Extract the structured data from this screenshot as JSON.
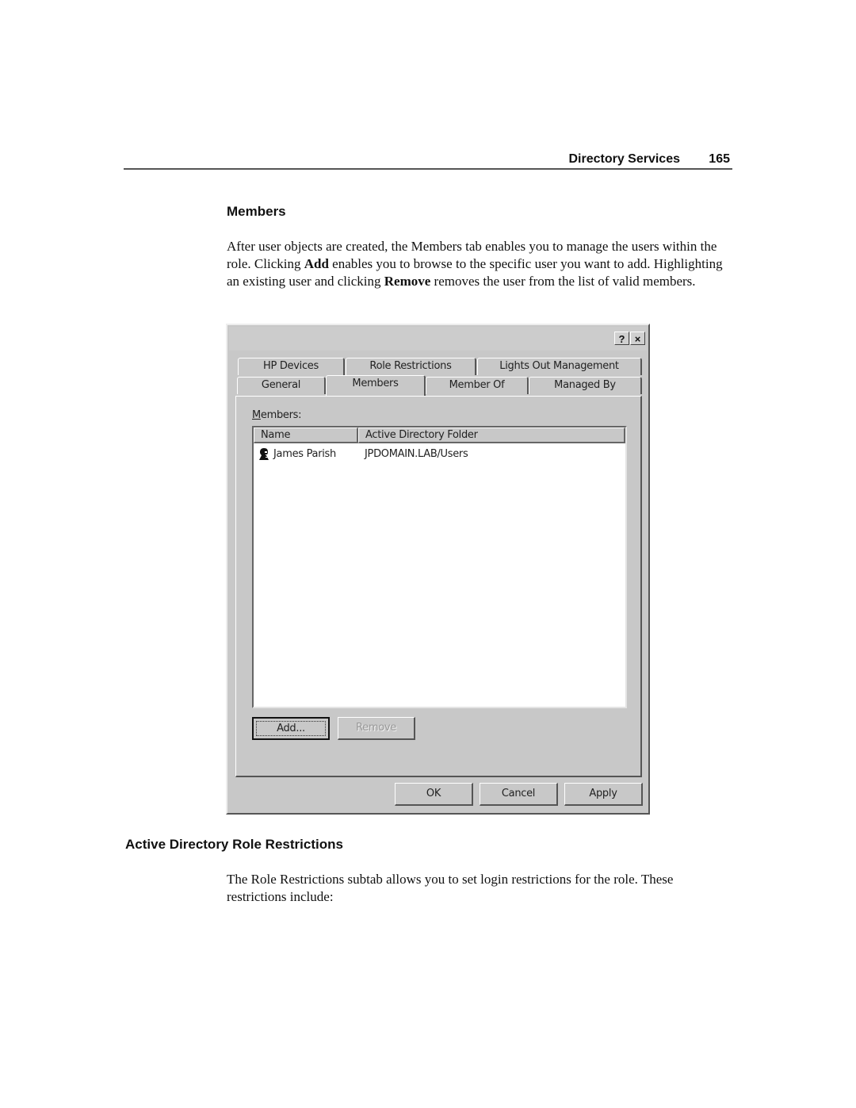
{
  "running_header": {
    "section": "Directory Services",
    "page_number": "165"
  },
  "members_section": {
    "heading": "Members",
    "paragraph": [
      {
        "text": "After user objects are created, the Members tab enables you to manage the users within the role. Clicking ",
        "bold": false
      },
      {
        "text": "Add",
        "bold": true
      },
      {
        "text": " enables you to browse to the specific user you want to add. Highlighting an existing user and clicking ",
        "bold": false
      },
      {
        "text": "Remove",
        "bold": true
      },
      {
        "text": " removes the user from the list of valid members.",
        "bold": false
      }
    ]
  },
  "dialog": {
    "titlebar_buttons": {
      "help": "?",
      "close": "×"
    },
    "tabs_row_back": [
      "HP Devices",
      "Role Restrictions",
      "Lights Out Management"
    ],
    "tabs_row_front": [
      "General",
      "Members",
      "Member Of",
      "Managed By"
    ],
    "active_tab": "Members",
    "members_label": "Members:",
    "members_label_mnemonic": "M",
    "list": {
      "columns": [
        "Name",
        "Active Directory Folder"
      ],
      "rows": [
        {
          "icon": "user-icon",
          "name": "James Parish",
          "folder": "JPDOMAIN.LAB/Users"
        }
      ]
    },
    "add_button": "Add...",
    "remove_button": "Remove",
    "remove_enabled": false,
    "ok_button": "OK",
    "cancel_button": "Cancel",
    "apply_button": "Apply"
  },
  "restrictions_section": {
    "heading": "Active Directory Role Restrictions",
    "paragraph": "The Role Restrictions subtab allows you to set login restrictions for the role. These restrictions include:"
  }
}
